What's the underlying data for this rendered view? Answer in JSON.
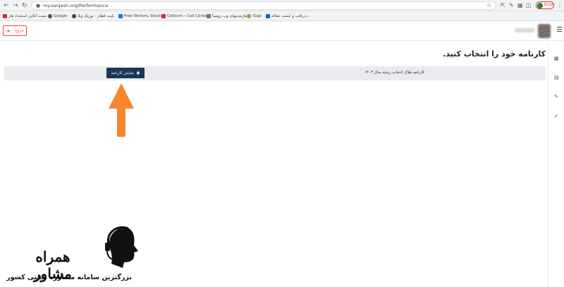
{
  "browser": {
    "url": "my.sanjesh.org/Performance",
    "profile_label": "Error",
    "bookmarks": [
      {
        "label": "تست آنلاین استعداد هاز...",
        "color": "#c0392b"
      },
      {
        "label": "Google",
        "color": "#555555"
      },
      {
        "label": "بلیت قطار - بوریک وبلا",
        "color": "#444444"
      },
      {
        "label": "Free Vectors, Stock...",
        "color": "#1a73e8"
      },
      {
        "label": "Cellcom – Cell Cente...",
        "color": "#d81b60"
      },
      {
        "label": "نیازمندیهای وب رومینا",
        "color": "#777777"
      },
      {
        "label": "iGap",
        "color": "#7cb342"
      },
      {
        "label": "دریافت و لیست مقاله...",
        "color": "#1565c0"
      }
    ]
  },
  "header": {
    "logout_label": "خروج"
  },
  "main": {
    "title": "کارنامه خود را انتخاب کنید.",
    "row_label": "کارنامه ملاک انتخاب رشته سال ۱۴۰۳",
    "show_button_label": "نمایش کارنامه"
  },
  "watermark": {
    "title": "همراه مشاور",
    "subtitle": "بزرگترین سامانه مشاوره تلفنی کشور"
  },
  "colors": {
    "button_bg": "#1d3557",
    "arrow": "#f7862f",
    "logout": "#e24c4b"
  }
}
